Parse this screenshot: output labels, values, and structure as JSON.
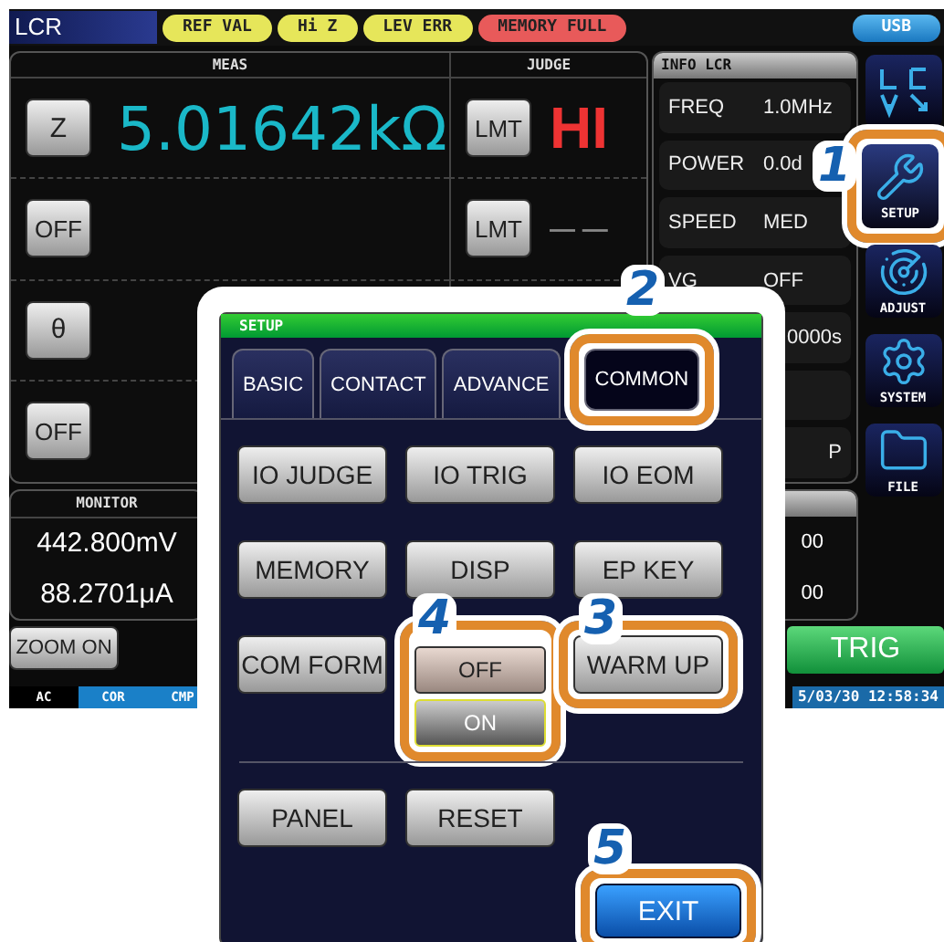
{
  "top_bar": {
    "title": "LCR",
    "badges": [
      {
        "label": "REF VAL",
        "color": "#e6e65a"
      },
      {
        "label": "Hi Z",
        "color": "#e6e65a"
      },
      {
        "label": "LEV ERR",
        "color": "#e6e65a"
      },
      {
        "label": "MEMORY FULL",
        "color": "#e85a5a"
      }
    ],
    "usb": "USB"
  },
  "meas": {
    "header": "MEAS",
    "judge_header": "JUDGE",
    "rows": [
      {
        "param": "Z",
        "value": "5.01642kΩ",
        "limit": "LMT",
        "judge": "HI",
        "kind": "judged"
      },
      {
        "param": "OFF",
        "limit": "LMT",
        "judge": "— —",
        "kind": "blank"
      },
      {
        "param": "θ",
        "kind": "param"
      },
      {
        "param": "OFF",
        "kind": "param"
      }
    ]
  },
  "info": {
    "title": "INFO LCR",
    "rows": [
      {
        "label": "FREQ",
        "value": "1.0MHz"
      },
      {
        "label": "POWER",
        "value": "0.0d"
      },
      {
        "label": "SPEED",
        "value": "MED"
      },
      {
        "label": "VG",
        "value": "OFF"
      },
      {
        "value": "0000s"
      },
      {},
      {
        "value": "P"
      }
    ]
  },
  "monitor": {
    "title": "MONITOR",
    "values": [
      "442.800mV",
      "88.2701μA"
    ]
  },
  "info2": {
    "values": [
      "00",
      "00"
    ]
  },
  "zoom_button": "ZOOM ON",
  "status_tags": [
    {
      "label": "AC",
      "active": false
    },
    {
      "label": "COR",
      "active": true
    },
    {
      "label": "CMP",
      "active": true
    }
  ],
  "trig_button": "TRIG",
  "datetime": "5/03/30 12:58:34",
  "side_buttons": [
    {
      "kind": "logo",
      "highlighted": false
    },
    {
      "kind": "wrench",
      "label": "SETUP",
      "highlighted": true
    },
    {
      "kind": "target",
      "label": "ADJUST",
      "highlighted": false
    },
    {
      "kind": "gear",
      "label": "SYSTEM",
      "highlighted": false
    },
    {
      "kind": "folder",
      "label": "FILE",
      "highlighted": false
    }
  ],
  "dialog": {
    "title": "SETUP",
    "tabs": [
      {
        "label": "BASIC",
        "selected": false,
        "highlighted": false
      },
      {
        "label": "CONTACT",
        "selected": false,
        "highlighted": false
      },
      {
        "label": "ADVANCE",
        "selected": false,
        "highlighted": false
      },
      {
        "label": "COMMON",
        "selected": true,
        "highlighted": true
      }
    ],
    "buttons": [
      {
        "label": "IO JUDGE",
        "kind": "button",
        "highlighted": false
      },
      {
        "label": "IO TRIG",
        "kind": "button",
        "highlighted": false
      },
      {
        "label": "IO EOM",
        "kind": "button",
        "highlighted": false
      },
      {
        "label": "MEMORY",
        "kind": "button",
        "highlighted": false
      },
      {
        "label": "DISP",
        "kind": "button",
        "highlighted": false
      },
      {
        "label": "EP KEY",
        "kind": "button",
        "highlighted": false
      },
      {
        "label": "COM FORM",
        "kind": "button",
        "highlighted": false
      },
      {
        "kind": "toggle",
        "highlighted": true,
        "options": [
          {
            "label": "OFF",
            "selected": false
          },
          {
            "label": "ON",
            "selected": true
          }
        ]
      },
      {
        "label": "WARM UP",
        "kind": "button",
        "highlighted": true
      }
    ],
    "bottom_buttons": [
      {
        "label": "PANEL",
        "highlighted": false
      },
      {
        "label": "RESET",
        "highlighted": false
      }
    ],
    "exit": {
      "label": "EXIT",
      "highlighted": true
    }
  },
  "callouts": [
    "1",
    "2",
    "3",
    "4",
    "5"
  ]
}
